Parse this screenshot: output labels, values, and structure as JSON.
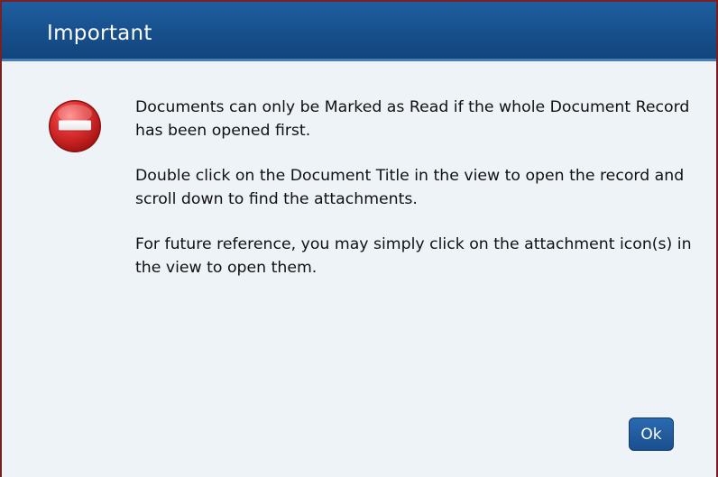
{
  "dialog": {
    "title": "Important",
    "icon": "stop-error-icon",
    "accent_color": "#1a528f",
    "icon_color": "#d42a2a",
    "paragraphs": [
      "Documents can only be Marked as Read if the whole Document Record has been opened first.",
      "Double click on the Document Title in the view to open the record and scroll down to find the attachments.",
      "For future reference, you may simply click on the attachment icon(s) in the view to open them."
    ],
    "ok_label": "Ok"
  }
}
